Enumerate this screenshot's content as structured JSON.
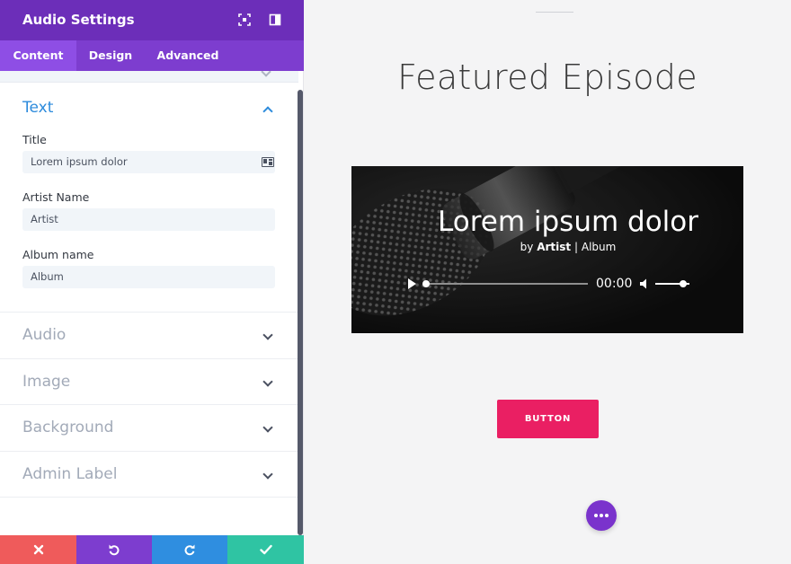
{
  "panel": {
    "title": "Audio Settings",
    "header_icons": [
      "expand-icon",
      "split-view-icon"
    ],
    "tabs": [
      {
        "label": "Content",
        "active": true
      },
      {
        "label": "Design",
        "active": false
      },
      {
        "label": "Advanced",
        "active": false
      }
    ],
    "text_group": {
      "title": "Text",
      "expanded": true,
      "fields": [
        {
          "label": "Title",
          "value": "Lorem ipsum dolor"
        },
        {
          "label": "Artist Name",
          "value": "Artist"
        },
        {
          "label": "Album name",
          "value": "Album"
        }
      ]
    },
    "collapsed_groups": [
      "Audio",
      "Image",
      "Background",
      "Admin Label"
    ],
    "footer_actions": [
      "discard",
      "undo",
      "redo",
      "save"
    ]
  },
  "preview": {
    "heading": "Featured Episode",
    "player": {
      "title": "Lorem ipsum dolor",
      "by": "by",
      "artist": "Artist",
      "separator": "|",
      "album": "Album",
      "time": "00:00",
      "progress": 0,
      "volume": 0.8
    },
    "button_label": "BUTTON"
  },
  "colors": {
    "panel_header": "#6c2eb9",
    "tabs_bar": "#7d3dcf",
    "accent_blue": "#2d8bdc",
    "cta": "#ea1f63",
    "fab": "#7a33cc",
    "discard": "#ef5b5b",
    "undo": "#7d3dcf",
    "redo": "#2f8ee0",
    "save": "#2fc4a3"
  }
}
